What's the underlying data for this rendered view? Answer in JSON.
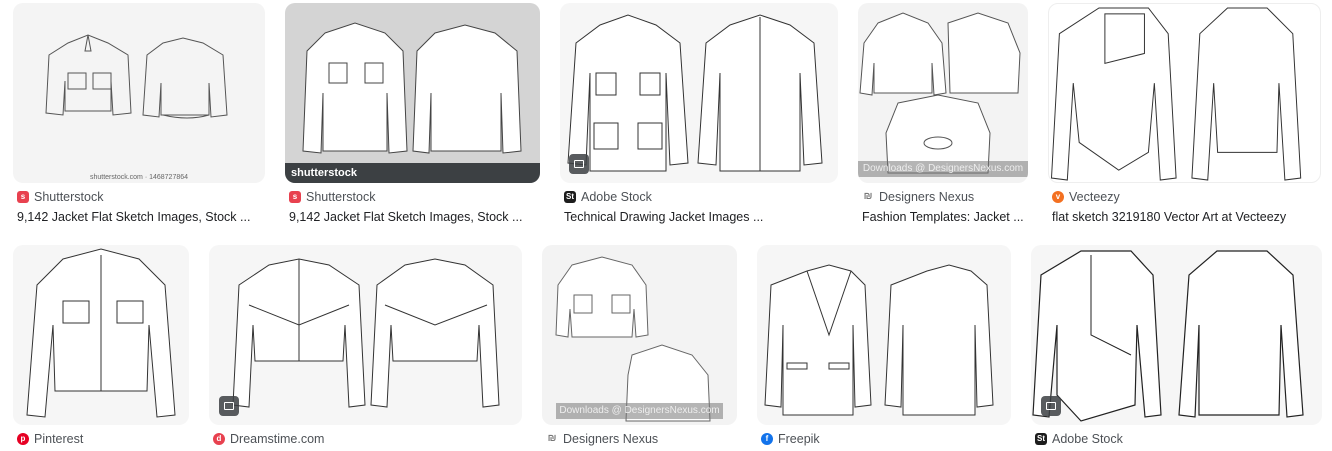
{
  "results": [
    {
      "source": "Shutterstock",
      "title": "9,142 Jacket Flat Sketch Images, Stock ...",
      "thumb_caption": "shutterstock.com · 1468727864"
    },
    {
      "source": "Shutterstock",
      "title": "9,142 Jacket Flat Sketch Images, Stock ...",
      "watermark": "shutterstock"
    },
    {
      "source": "Adobe Stock",
      "title": "Technical Drawing Jacket Images ..."
    },
    {
      "source": "Designers Nexus",
      "title": "Fashion Templates: Jacket ...",
      "watermark": "Downloads @ DesignersNexus.com"
    },
    {
      "source": "Vecteezy",
      "title": "flat sketch 3219180 Vector Art at Vecteezy"
    },
    {
      "source": "Pinterest"
    },
    {
      "source": "Dreamstime.com"
    },
    {
      "source": "Designers Nexus",
      "watermark": "Downloads @ DesignersNexus.com"
    },
    {
      "source": "Freepik"
    },
    {
      "source": "Adobe Stock"
    }
  ],
  "colors": {
    "shutterstock": "#e8414f",
    "adobe": "#1d1d1d",
    "pinterest": "#e60023",
    "dreamstime": "#e8414f",
    "vecteezy": "#f37021",
    "freepik": "#1273eb"
  },
  "icons": [
    "image-icon",
    "favicon"
  ]
}
